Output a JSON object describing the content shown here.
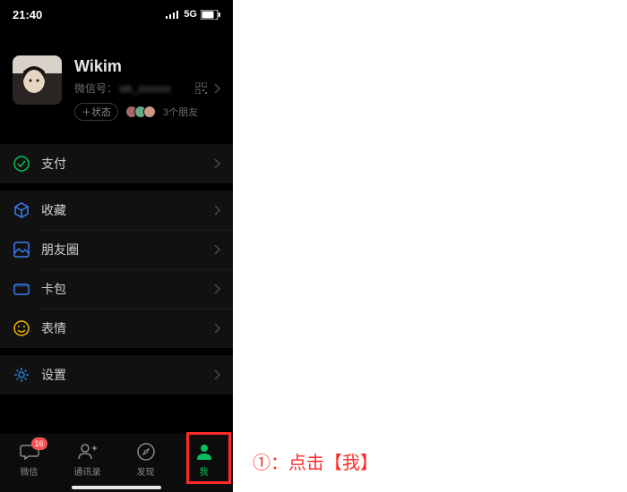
{
  "status": {
    "time": "21:40",
    "network": "5G"
  },
  "profile": {
    "name": "Wikim",
    "id_label": "微信号：",
    "id_value": "wk_xxxxxx",
    "status_btn": "＋状态",
    "friends_text": "3个朋友"
  },
  "menu": {
    "pay": "支付",
    "fav": "收藏",
    "moments": "朋友圈",
    "cards": "卡包",
    "stickers": "表情",
    "settings": "设置"
  },
  "tabs": {
    "chat": "微信",
    "chat_badge": "16",
    "contacts": "通讯录",
    "discover": "发现",
    "me": "我"
  },
  "annotation": "①：点击【我】",
  "colors": {
    "accent": "#07c160",
    "highlight": "#ff2a2a",
    "icon_pay": "#07c160",
    "icon_fav": "#3e7cf0",
    "icon_moments": "#3e7cf0",
    "icon_cards": "#3e7cf0",
    "icon_stickers": "#f7b500",
    "icon_settings": "#2a82e4"
  }
}
